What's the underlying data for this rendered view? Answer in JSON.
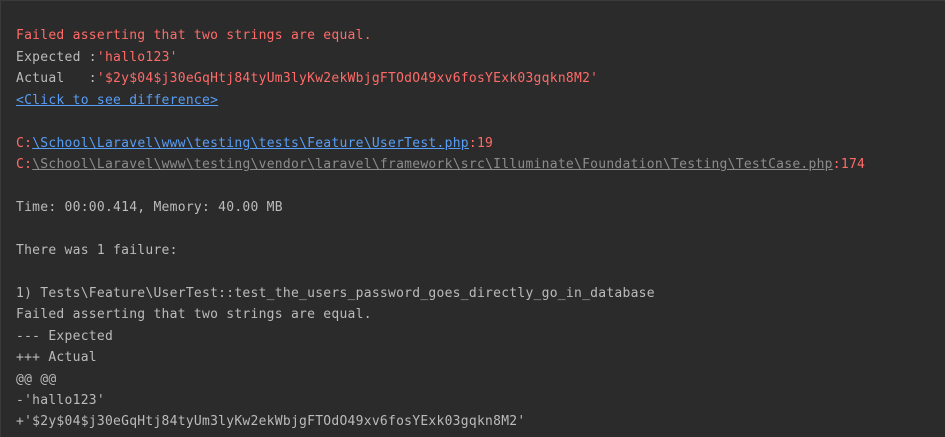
{
  "assertion": {
    "message": "Failed asserting that two strings are equal.",
    "expected_label": "Expected :",
    "expected_value": "'hallo123'",
    "actual_label": "Actual   :",
    "actual_value": "'$2y$04$j30eGqHtj84tyUm3lyKw2ekWbjgFTOdO49xv6fosYExk03gqkn8M2'",
    "diff_link": "<Click to see difference>"
  },
  "stack": [
    {
      "drive": "C:",
      "path": "\\School\\Laravel\\www\\testing\\tests\\Feature\\UserTest.php",
      "line": ":19"
    },
    {
      "drive": "C:",
      "path": "\\School\\Laravel\\www\\testing\\vendor\\laravel\\framework\\src\\Illuminate\\Foundation\\Testing\\TestCase.php",
      "line": ":174"
    }
  ],
  "summary": {
    "time_memory": "Time: 00:00.414, Memory: 40.00 MB",
    "failures": "There was 1 failure:"
  },
  "failure": {
    "title": "1) Tests\\Feature\\UserTest::test_the_users_password_goes_directly_go_in_database",
    "message": "Failed asserting that two strings are equal.",
    "diff_expected_header": "--- Expected",
    "diff_actual_header": "+++ Actual",
    "diff_hunk": "@@ @@",
    "diff_removed": "-'hallo123'",
    "diff_added": "+'$2y$04$j30eGqHtj84tyUm3lyKw2ekWbjgFTOdO49xv6fosYExk03gqkn8M2'"
  },
  "colors": {
    "background": "#2b2b2b",
    "default_text": "#bbbbbb",
    "error_red": "#ff6b68",
    "link_blue": "#589df6",
    "link_gray": "#8c8c8c"
  }
}
